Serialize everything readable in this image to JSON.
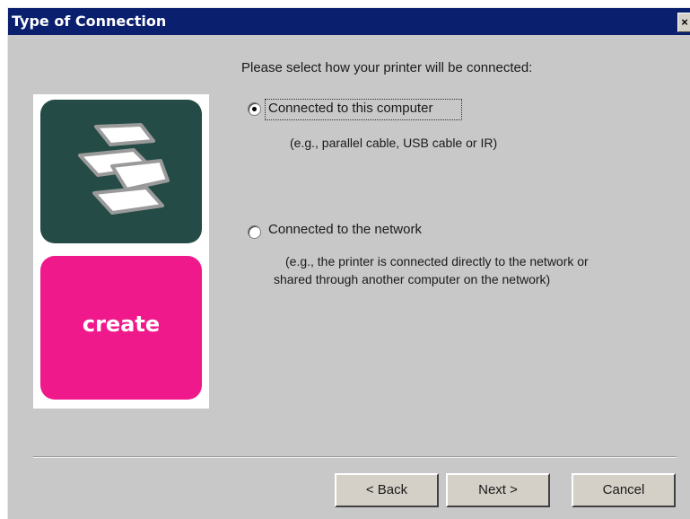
{
  "window": {
    "title": "Type of Connection",
    "close_glyph": "×"
  },
  "illustration": {
    "logo_text": "create",
    "colors": {
      "top_tile": "#244b46",
      "bottom_tile": "#f0198c"
    }
  },
  "prompt": "Please select how your printer will be connected:",
  "options": [
    {
      "label": "Connected to this computer",
      "description": "(e.g., parallel cable, USB cable or IR)",
      "selected": true
    },
    {
      "label": "Connected to the network",
      "description_line1": "(e.g., the printer is connected directly to the network or",
      "description_line2": "shared through another computer on the network)",
      "selected": false
    }
  ],
  "buttons": {
    "back": "< Back",
    "next": "Next >",
    "cancel": "Cancel"
  }
}
